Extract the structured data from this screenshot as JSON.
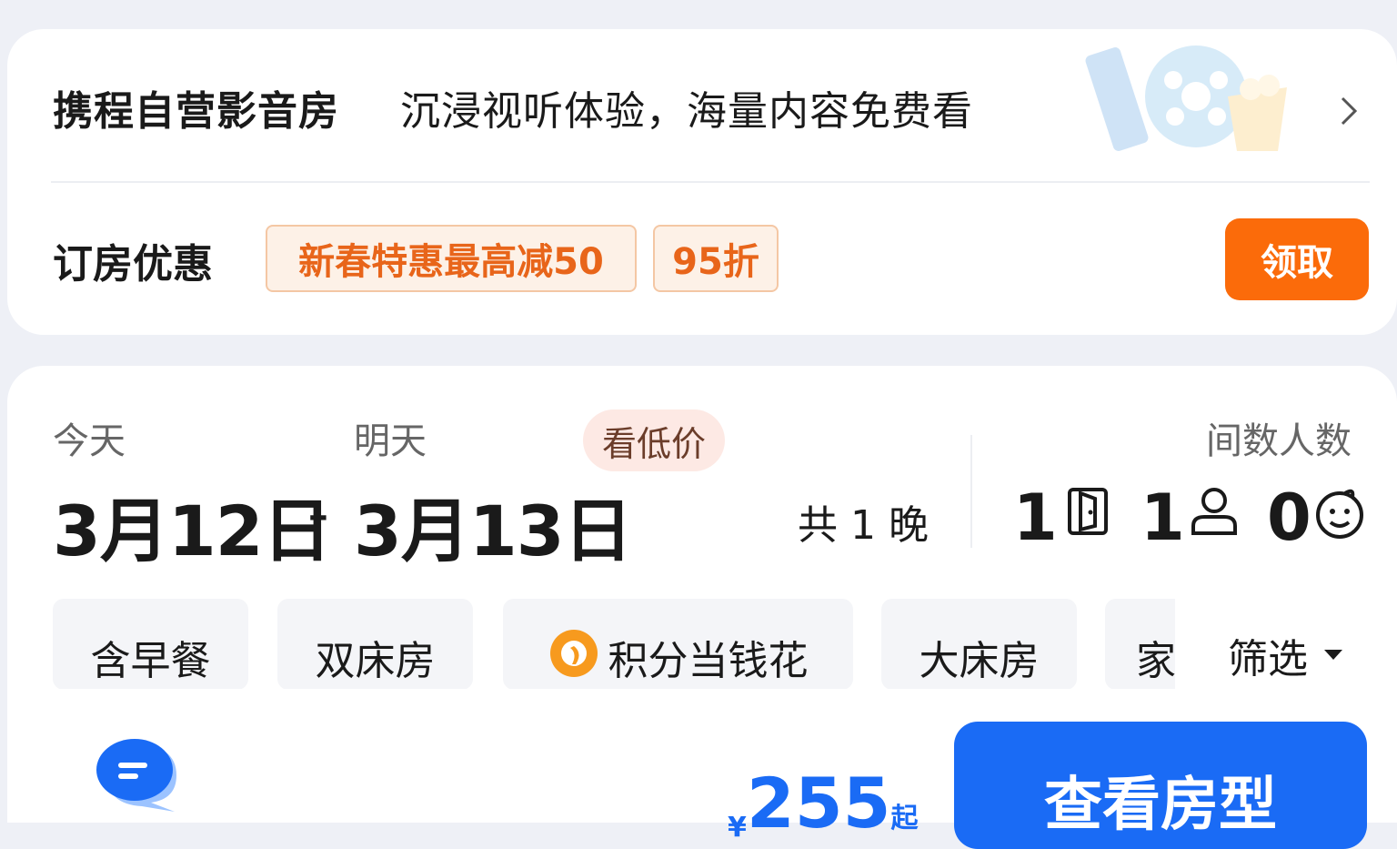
{
  "promo": {
    "title": "携程自营影音房",
    "description": "沉浸视听体验，海量内容免费看"
  },
  "discounts": {
    "label": "订房优惠",
    "tags": [
      "新春特惠最高减50",
      "95折"
    ],
    "claim_label": "领取"
  },
  "dates": {
    "checkin_day": "今天",
    "checkout_day": "明天",
    "low_price_label": "看低价",
    "checkin_date": "3月12日",
    "separator": "-",
    "checkout_date": "3月13日",
    "nights": "共 1 晚"
  },
  "occupancy": {
    "label": "间数人数",
    "rooms": "1",
    "adults": "1",
    "children": "0"
  },
  "filters": {
    "chips": [
      "含早餐",
      "双床房",
      "积分当钱花",
      "大床房",
      "家"
    ],
    "filter_label": "筛选"
  },
  "footer": {
    "currency": "¥",
    "price": "255",
    "price_suffix": "起",
    "view_rooms_label": "查看房型"
  },
  "colors": {
    "accent_orange": "#fb6b0a",
    "tag_text": "#e8651a",
    "primary_blue": "#1a6bf5"
  }
}
